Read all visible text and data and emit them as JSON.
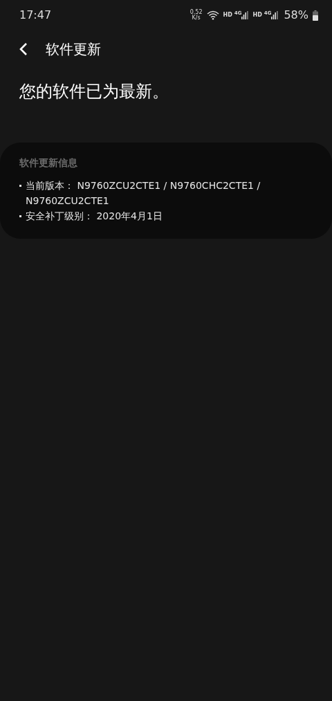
{
  "status_bar": {
    "time": "17:47",
    "net_speed": "0.52",
    "net_unit": "K/s",
    "networks": [
      {
        "hd": "HD",
        "gen": "4G"
      },
      {
        "hd": "HD",
        "gen": "4G"
      }
    ],
    "battery": "58%"
  },
  "header": {
    "title": "软件更新"
  },
  "message": "您的软件已为最新。",
  "info_card": {
    "title": "软件更新信息",
    "items": [
      {
        "label": "当前版本：",
        "value": "N9760ZCU2CTE1 / N9760CHC2CTE1 / N9760ZCU2CTE1"
      },
      {
        "label": "安全补丁级别：",
        "value": "2020年4月1日"
      }
    ]
  }
}
